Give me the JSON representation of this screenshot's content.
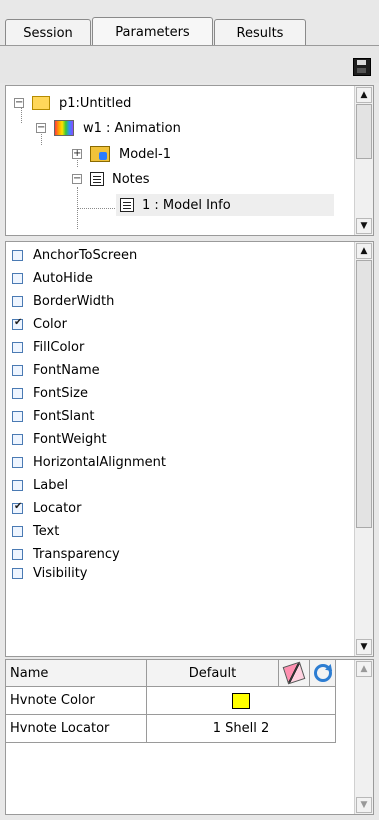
{
  "tabs": [
    {
      "label": "Session"
    },
    {
      "label": "Parameters"
    },
    {
      "label": "Results"
    }
  ],
  "tree": {
    "items": [
      {
        "label": "p1:Untitled"
      },
      {
        "label": "w1 : Animation"
      },
      {
        "label": "Model-1"
      },
      {
        "label": "Notes"
      },
      {
        "label": "1 : Model Info"
      }
    ]
  },
  "attributes": [
    {
      "label": "AnchorToScreen",
      "checked": false
    },
    {
      "label": "AutoHide",
      "checked": false
    },
    {
      "label": "BorderWidth",
      "checked": false
    },
    {
      "label": "Color",
      "checked": true
    },
    {
      "label": "FillColor",
      "checked": false
    },
    {
      "label": "FontName",
      "checked": false
    },
    {
      "label": "FontSize",
      "checked": false
    },
    {
      "label": "FontSlant",
      "checked": false
    },
    {
      "label": "FontWeight",
      "checked": false
    },
    {
      "label": "HorizontalAlignment",
      "checked": false
    },
    {
      "label": "Label",
      "checked": false
    },
    {
      "label": "Locator",
      "checked": true
    },
    {
      "label": "Text",
      "checked": false
    },
    {
      "label": "Transparency",
      "checked": false
    },
    {
      "label": "Visibility",
      "checked": false
    }
  ],
  "table": {
    "headers": {
      "name": "Name",
      "default": "Default"
    },
    "rows": [
      {
        "name": "Hvnote Color",
        "value": "",
        "swatch": "#ffff00"
      },
      {
        "name": "Hvnote Locator",
        "value": "1 Shell 2"
      }
    ]
  },
  "icons": {
    "save": "save-icon",
    "eraser": "eraser-icon",
    "refresh": "refresh-icon"
  }
}
